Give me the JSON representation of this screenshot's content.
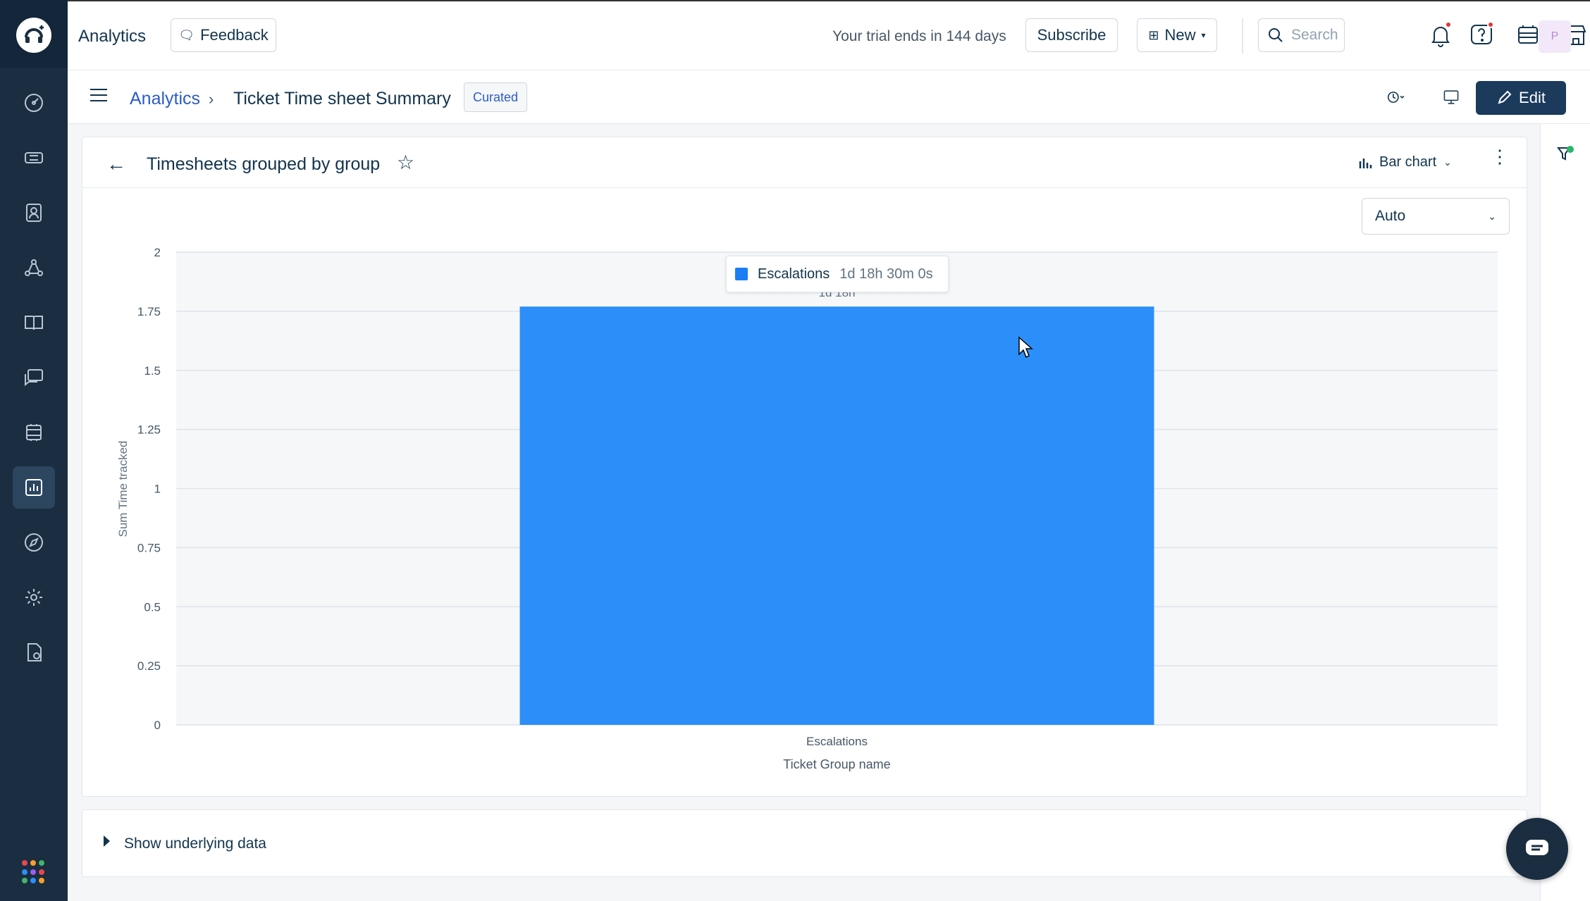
{
  "header": {
    "app_title": "Analytics",
    "feedback_label": "Feedback",
    "trial_text": "Your trial ends in 144 days",
    "subscribe_label": "Subscribe",
    "new_label": "New",
    "search_placeholder": "Search",
    "avatar_initial": "P"
  },
  "subheader": {
    "breadcrumb_root": "Analytics",
    "breadcrumb_separator": "›",
    "report_title": "Ticket Time sheet Summary",
    "badge": "Curated",
    "edit_label": "Edit"
  },
  "widget": {
    "title": "Timesheets grouped by group",
    "chart_type_label": "Bar chart",
    "scale_select_value": "Auto",
    "tooltip": {
      "series_name": "Escalations",
      "value": "1d 18h 30m 0s"
    }
  },
  "underlying": {
    "label": "Show underlying data"
  },
  "colors": {
    "rail_bg": "#1b2d40",
    "bar": "#2c8ff9",
    "edit_bg": "#1b3a5c",
    "link": "#2c5cc5"
  },
  "icons": {
    "rail": [
      "dashboard-icon",
      "tickets-icon",
      "contacts-icon",
      "groups-icon",
      "solutions-icon",
      "conversations-icon",
      "assets-icon",
      "analytics-icon",
      "explore-icon",
      "settings-icon",
      "reports-refresh-icon"
    ],
    "top": [
      "bell-icon",
      "help-icon",
      "inbox-icon",
      "marketplace-icon"
    ]
  },
  "chart_data": {
    "type": "bar",
    "categories": [
      "Escalations"
    ],
    "series": [
      {
        "name": "Escalations",
        "values": [
          1.77
        ]
      }
    ],
    "data_labels": [
      "1d 18h"
    ],
    "xlabel": "Ticket Group name",
    "ylabel": "Sum Time tracked",
    "ylim": [
      0,
      2
    ],
    "yticks": [
      "0",
      "0.25",
      "0.5",
      "0.75",
      "1",
      "1.25",
      "1.5",
      "1.75",
      "2"
    ],
    "grid": true
  }
}
